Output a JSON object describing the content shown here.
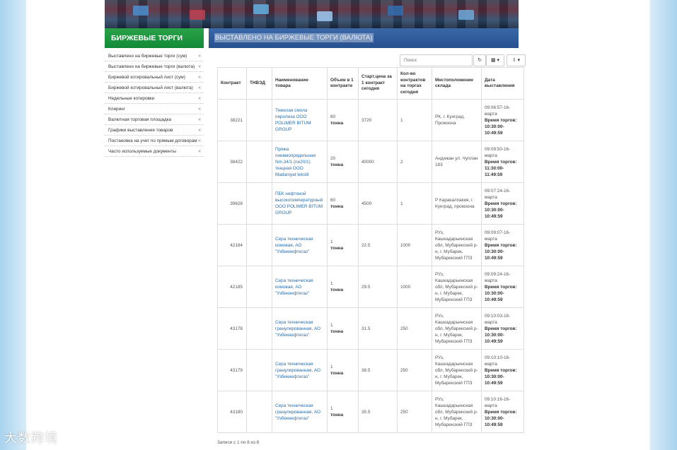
{
  "header": {
    "left_title": "БИРЖЕВЫЕ ТОРГИ",
    "page_title": "ВЫСТАВЛЕНО НА БИРЖЕВЫЕ ТОРГИ (ВАЛЮТА)"
  },
  "sidebar": {
    "items": [
      {
        "label": "Выставлено на биржевые торги (сум)"
      },
      {
        "label": "Выставлено на биржевые торги (валюта)"
      },
      {
        "label": "Биржевой котировальный лист (сум)"
      },
      {
        "label": "Биржевой котировальный лист (валюта)"
      },
      {
        "label": "Недельные котировки"
      },
      {
        "label": "Клиринг"
      },
      {
        "label": "Валютная торговая площадка"
      },
      {
        "label": "Графики выставления товаров"
      },
      {
        "label": "Постановка на учет по прямым договорам"
      },
      {
        "label": "Часто используемые документы"
      }
    ],
    "arrow": "«"
  },
  "toolbar": {
    "search_placeholder": "Поиск",
    "refresh_icon": "↻",
    "columns_label": "▦ ▾",
    "export_label": "⇩ ▾"
  },
  "table": {
    "columns": [
      "Контракт",
      "ТНВЭД",
      "Наименование товара",
      "Объем в 1 контракте",
      "Старт.цена за 1 контракт сегодня",
      "Кол-во контрактов на торгах сегодня",
      "Местоположение склада",
      "Дата выставления"
    ],
    "rows": [
      {
        "contract": "38221",
        "tnved": "",
        "name": "Тяжелая смола пиролиза ООО POLIMER BITUM GROUP",
        "volume": "60",
        "unit": "тонна",
        "price": "3720",
        "count": "1",
        "location": "РК, г. Кунград, Промзона",
        "date": "09:06:57-16-марта",
        "trade_label": "Время торгов:",
        "trade_time": "10:30:00-10:49:59"
      },
      {
        "contract": "38422",
        "tnved": "",
        "name": "Пряжа пневмопрядильная Nm.34/1 (ne20/1) ткацкая ООО Madaniyat tekstil",
        "volume": "20",
        "unit": "тонна",
        "price": "40000",
        "count": "2",
        "location": "Андижан ул. Чуллан 183",
        "date": "09:09:50-16-марта",
        "trade_label": "Время торгов:",
        "trade_time": "11:30:00-11:49:59"
      },
      {
        "contract": "39628",
        "tnved": "",
        "name": "ПБК нефтяной высокотемпературный ООО POLIMER BITUM GROUP",
        "volume": "60",
        "unit": "тонна",
        "price": "4500",
        "count": "1",
        "location": "Р Каракалпакия, г. Кунград, промзона",
        "date": "09:07:24-16-марта",
        "trade_label": "Время торгов:",
        "trade_time": "10:30:00-10:49:59"
      },
      {
        "contract": "42184",
        "tnved": "",
        "name": "Сера техническая комовая, АО \"Узбекнефтегаз\"",
        "volume": "1",
        "unit": "тонна",
        "price": "22.5",
        "count": "1000",
        "location": "РУз, Кашкадарьинская обл, Мубарекский р-н, г. Мубарек, Мубарекский ГПЗ",
        "date": "09:09:07-16-марта",
        "trade_label": "Время торгов:",
        "trade_time": "10:30:00-10:49:59"
      },
      {
        "contract": "42185",
        "tnved": "",
        "name": "Сера техническая комовая, АО \"Узбекнефтегаз\"",
        "volume": "1",
        "unit": "тонна",
        "price": "29.5",
        "count": "1000",
        "location": "РУз, Кашкадарьинская обл, Мубарекский р-н, г. Мубарек, Мубарекский ГПЗ",
        "date": "09:09:24-16-марта",
        "trade_label": "Время торгов:",
        "trade_time": "10:30:00-10:49:59"
      },
      {
        "contract": "43178",
        "tnved": "",
        "name": "Сера техническая гранулированная, АО \"Узбекнефтегаз\"",
        "volume": "1",
        "unit": "тонна",
        "price": "31.5",
        "count": "250",
        "location": "РУз, Кашкадарьинская обл, Мубарекский р-н, г. Мубарек, Мубарекский ГПЗ",
        "date": "09:10:03-16-марта",
        "trade_label": "Время торгов:",
        "trade_time": "10:30:00-10:49:59"
      },
      {
        "contract": "43179",
        "tnved": "",
        "name": "Сера техническая гранулированная, АО \"Узбекнефтегаз\"",
        "volume": "1",
        "unit": "тонна",
        "price": "38.5",
        "count": "250",
        "location": "РУз, Кашкадарьинская обл, Мубарекский р-н, г. Мубарек, Мубарекский ГПЗ",
        "date": "09:10:10-16-марта",
        "trade_label": "Время торгов:",
        "trade_time": "10:30:00-10:49:59"
      },
      {
        "contract": "43180",
        "tnved": "",
        "name": "Сера техническая гранулированная, АО \"Узбекнефтегаз\"",
        "volume": "1",
        "unit": "тонна",
        "price": "35.5",
        "count": "250",
        "location": "РУз, Кашкадарьинская обл, Мубарекский р-н, г. Мубарек, Мубарекский ГПЗ",
        "date": "09:10:16-16-марта",
        "trade_label": "Время торгов:",
        "trade_time": "10:30:00-10:49:59"
      }
    ]
  },
  "footer": {
    "records_info": "Записи с 1 по 8 из 8"
  },
  "watermark": {
    "text": "大数跨境"
  },
  "colors": {
    "green_header": "#1a9640",
    "blue_header": "#2f5c9c",
    "link": "#2a6fb0"
  }
}
